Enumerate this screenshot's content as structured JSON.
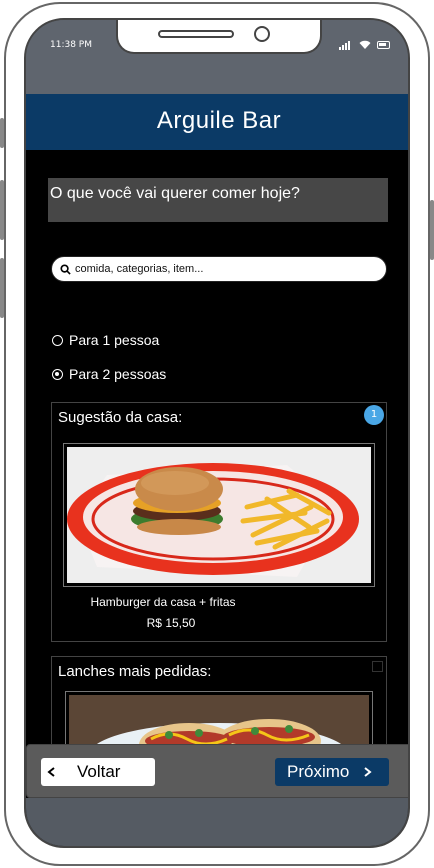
{
  "status": {
    "time": "11:38 PM"
  },
  "header": {
    "title": "Arguile Bar"
  },
  "question": "O que você vai querer comer hoje?",
  "search": {
    "placeholder": "comida, categorias, item..."
  },
  "options": [
    {
      "label": "Para 1 pessoa",
      "selected": false
    },
    {
      "label": "Para 2 pessoas",
      "selected": true
    }
  ],
  "suggestion": {
    "title": "Sugestão da casa:",
    "badge": "1",
    "item_name": "Hamburger da casa + fritas",
    "price": "R$ 15,50"
  },
  "popular": {
    "title": "Lanches mais pedidas:"
  },
  "footer": {
    "back_label": "Voltar",
    "next_label": "Próximo"
  },
  "colors": {
    "header": "#0b3a66",
    "accent": "#4aa7e6",
    "background": "#000000"
  }
}
